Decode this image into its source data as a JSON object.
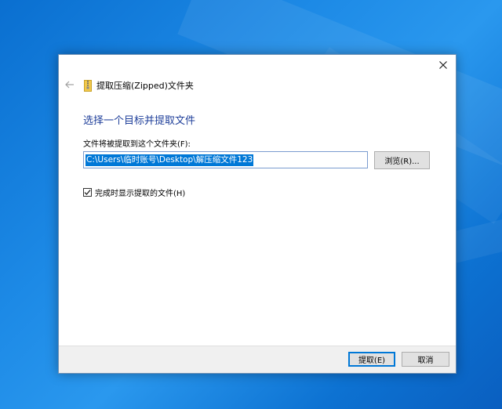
{
  "wizard": {
    "title": "提取压缩(Zipped)文件夹",
    "main_instruction": "选择一个目标并提取文件",
    "path_label": "文件将被提取到这个文件夹(F):",
    "path_value": "C:\\Users\\临时账号\\Desktop\\解压缩文件123",
    "browse_label": "浏览(R)...",
    "show_files_label": "完成时显示提取的文件(H)",
    "show_files_checked": true,
    "extract_label": "提取(E)",
    "cancel_label": "取消"
  },
  "icons": {
    "close": "close-icon",
    "back": "back-arrow-icon",
    "zip": "zip-folder-icon",
    "check": "checkmark-icon"
  },
  "colors": {
    "desktop_blue": "#1d8ae6",
    "instruction_blue": "#1f3f9a",
    "selection_blue": "#0078d7",
    "zip_yellow": "#f2c94c"
  }
}
